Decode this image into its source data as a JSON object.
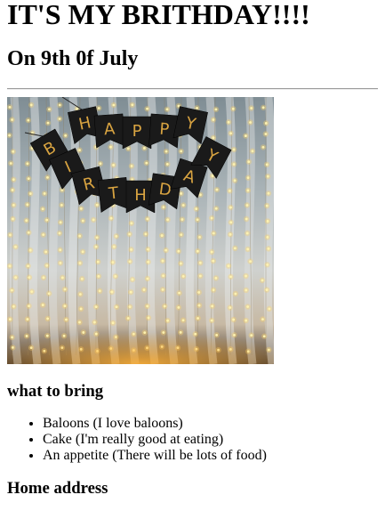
{
  "page": {
    "title": "IT'S MY BRITHDAY!!!!",
    "subtitle": "On 9th 0f July",
    "image": {
      "banner_letters_top": [
        "H",
        "A",
        "P",
        "P",
        "Y"
      ],
      "banner_letters_bottom": [
        "B",
        "I",
        "R",
        "T",
        "H",
        "D",
        "A",
        "Y"
      ]
    },
    "bring_heading": "what to bring",
    "bring_items": [
      "Baloons (I love baloons)",
      "Cake (I'm really good at eating)",
      "An appetite (There will be lots of food)"
    ],
    "address_heading": "Home address"
  },
  "colors": {
    "text": "#000000",
    "rule": "#9a9a9a",
    "flag": "#1a1a1a",
    "letter_gold": "#d9a441",
    "light": "#ffd66b"
  }
}
